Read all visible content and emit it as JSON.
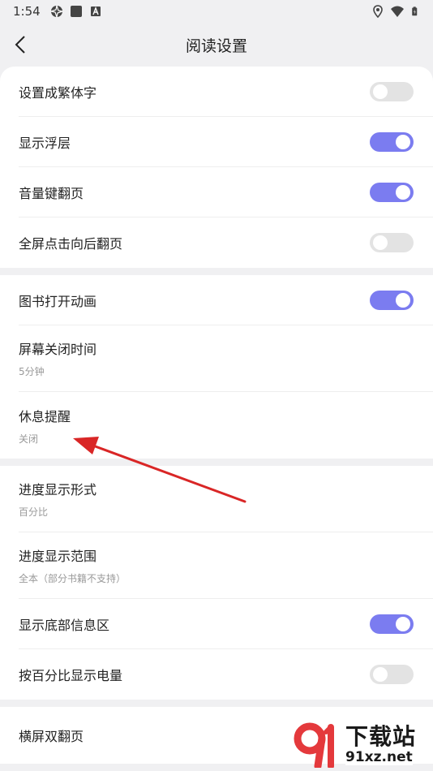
{
  "status_bar": {
    "time": "1:54",
    "left_icons": [
      "aperture-icon",
      "square-notification-icon",
      "a-notification-icon"
    ],
    "right_icons": [
      "location-icon",
      "wifi-icon",
      "battery-icon"
    ]
  },
  "header": {
    "title": "阅读设置",
    "back_icon": "chevron-left-icon"
  },
  "colors": {
    "accent": "#7b7cf0",
    "toggle_off": "#e3e3e3",
    "annotation_arrow": "#d92626",
    "watermark_red": "#e4393c"
  },
  "groups": [
    {
      "items": [
        {
          "label": "设置成繁体字",
          "toggle": false
        },
        {
          "label": "显示浮层",
          "toggle": true
        },
        {
          "label": "音量键翻页",
          "toggle": true
        },
        {
          "label": "全屏点击向后翻页",
          "toggle": false
        }
      ]
    },
    {
      "items": [
        {
          "label": "图书打开动画",
          "toggle": true
        },
        {
          "label": "屏幕关闭时间",
          "sub": "5分钟"
        },
        {
          "label": "休息提醒",
          "sub": "关闭"
        }
      ]
    },
    {
      "items": [
        {
          "label": "进度显示形式",
          "sub": "百分比"
        },
        {
          "label": "进度显示范围",
          "sub": "全本（部分书籍不支持）"
        },
        {
          "label": "显示底部信息区",
          "toggle": true
        },
        {
          "label": "按百分比显示电量",
          "toggle": false
        }
      ]
    },
    {
      "items": [
        {
          "label": "横屏双翻页"
        }
      ]
    }
  ],
  "watermark": {
    "title": "下载站",
    "site": "91xz.net"
  }
}
